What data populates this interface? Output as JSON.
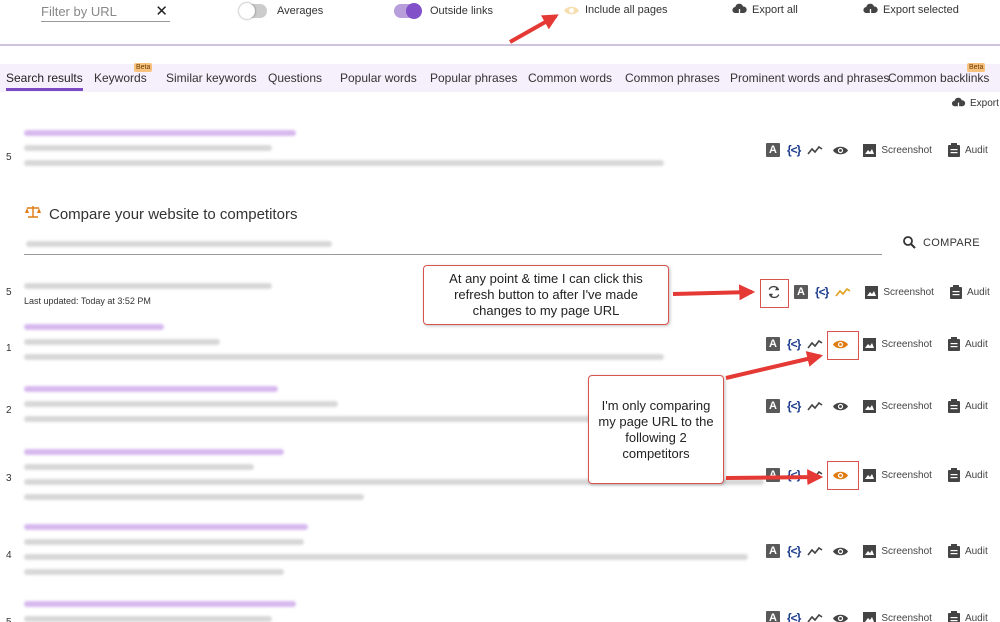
{
  "toolbar": {
    "filter_placeholder": "Filter by URL",
    "clear_symbol": "✕",
    "averages_label": "Averages",
    "averages_on": false,
    "outside_links_label": "Outside links",
    "outside_links_on": true,
    "include_all_pages_label": "Include all pages",
    "export_all_label": "Export all",
    "export_selected_label": "Export selected"
  },
  "tabs": [
    {
      "label": "Search results",
      "active": true,
      "beta": false
    },
    {
      "label": "Keywords",
      "active": false,
      "beta": true
    },
    {
      "label": "Similar keywords",
      "active": false,
      "beta": false
    },
    {
      "label": "Questions",
      "active": false,
      "beta": false
    },
    {
      "label": "Popular words",
      "active": false,
      "beta": false
    },
    {
      "label": "Popular phrases",
      "active": false,
      "beta": false
    },
    {
      "label": "Common words",
      "active": false,
      "beta": false
    },
    {
      "label": "Common phrases",
      "active": false,
      "beta": false
    },
    {
      "label": "Prominent words and phrases",
      "active": false,
      "beta": false
    },
    {
      "label": "Common backlinks",
      "active": false,
      "beta": true
    }
  ],
  "beta_label": "Beta",
  "export_label": "Export",
  "actions": {
    "a_letter": "A",
    "code_glyph": "{<}",
    "screenshot_label": "Screenshot",
    "audit_label": "Audit"
  },
  "compare": {
    "title": "Compare your website to competitors",
    "button_label": "COMPARE"
  },
  "my_row": {
    "rank": "5",
    "last_updated": "Last updated: Today at 3:52 PM"
  },
  "top_row": {
    "rank": "5"
  },
  "competitor_rows": [
    {
      "rank": "1",
      "eye_active": true
    },
    {
      "rank": "2",
      "eye_active": false
    },
    {
      "rank": "3",
      "eye_active": true
    },
    {
      "rank": "4",
      "eye_active": false
    },
    {
      "rank": "5",
      "eye_active": false
    }
  ],
  "annotations": {
    "refresh_note": "At any point & time I can click this refresh button to after I've made changes to my page URL",
    "compare_note": "I'm only comparing my page URL to the following 2 competitors"
  },
  "colors": {
    "accent": "#7a4bc1",
    "active_eye": "#e07b12",
    "annotation_red": "#e53935"
  }
}
